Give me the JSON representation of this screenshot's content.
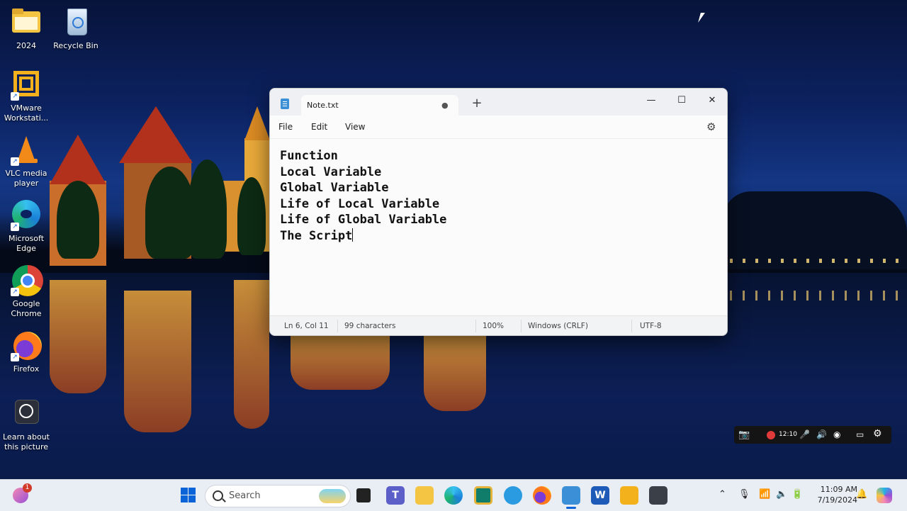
{
  "desktop": {
    "icons": [
      {
        "label": "2024",
        "icon": "folder-icon"
      },
      {
        "label": "Recycle Bin",
        "icon": "recycle-bin-icon"
      },
      {
        "label": "VMware Workstati...",
        "icon": "vmware-icon"
      },
      {
        "label": "VLC media player",
        "icon": "vlc-icon"
      },
      {
        "label": "Microsoft Edge",
        "icon": "edge-icon"
      },
      {
        "label": "Google Chrome",
        "icon": "chrome-icon"
      },
      {
        "label": "Firefox",
        "icon": "firefox-icon"
      },
      {
        "label": "Learn about this picture",
        "icon": "camera-icon"
      }
    ]
  },
  "notepad": {
    "tab_title": "Note.txt",
    "tab_modified": "●",
    "new_tab": "+",
    "minimize": "—",
    "maximize": "☐",
    "close": "✕",
    "menu": {
      "file": "File",
      "edit": "Edit",
      "view": "View"
    },
    "settings_icon": "⚙",
    "lines": [
      "Function",
      "Local Variable",
      "Global Variable",
      "Life of Local Variable",
      "Life of Global Variable",
      "The Script"
    ],
    "status": {
      "position": "Ln 6, Col 11",
      "characters": "99 characters",
      "zoom": "100%",
      "line_ending": "Windows (CRLF)",
      "encoding": "UTF-8"
    }
  },
  "recorder": {
    "time": "12:10"
  },
  "taskbar": {
    "search_placeholder": "Search",
    "notification_badge": "1",
    "time": "11:09 AM",
    "date": "7/19/2024",
    "colors": {
      "accent": "#0a64d8"
    }
  }
}
